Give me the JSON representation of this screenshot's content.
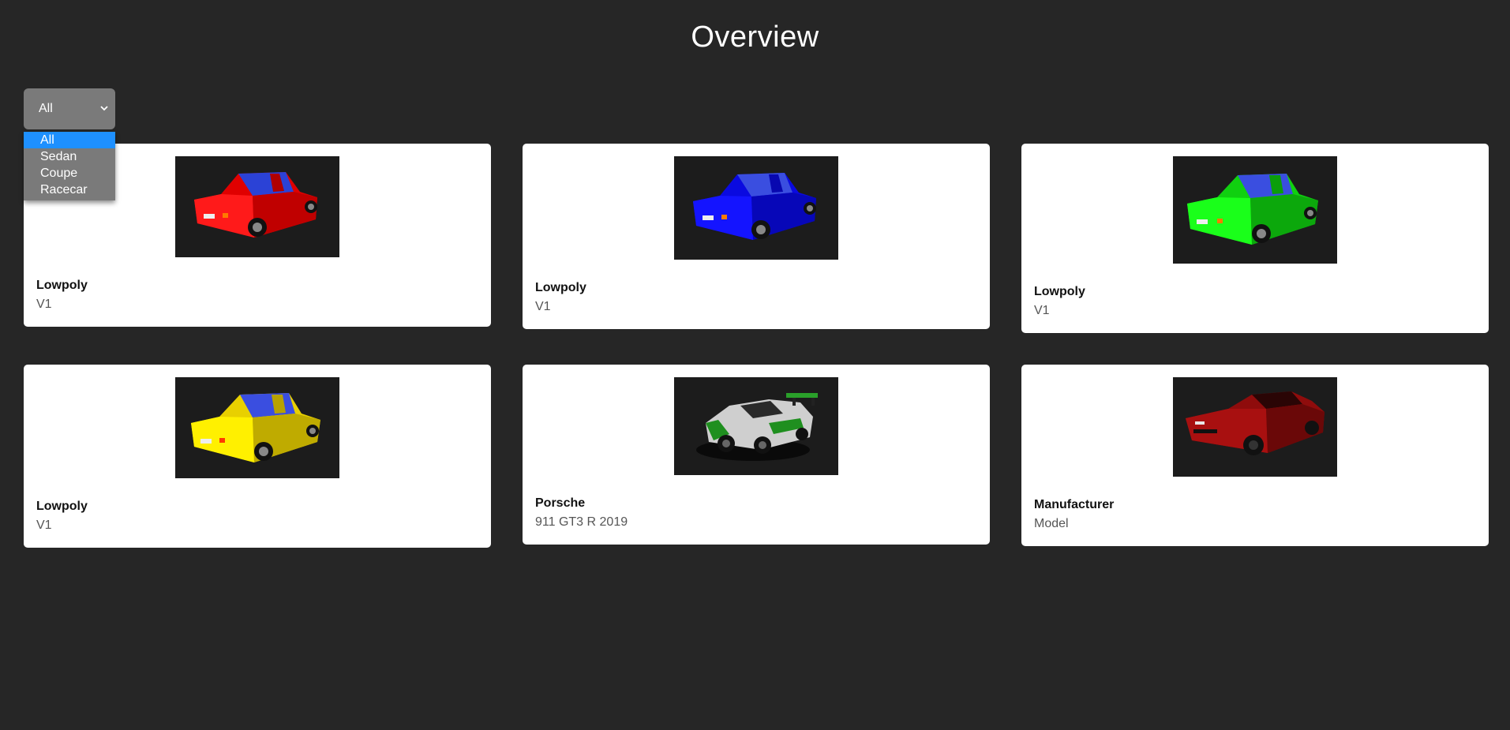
{
  "page": {
    "title": "Overview"
  },
  "filter": {
    "selected": "All",
    "options": [
      "All",
      "Sedan",
      "Coupe",
      "Racecar"
    ],
    "highlight_color": "#1e90ff"
  },
  "cards": [
    {
      "name": "Lowpoly",
      "model": "V1",
      "image": "red-lowpoly-sedan",
      "color": "#e00000"
    },
    {
      "name": "Lowpoly",
      "model": "V1",
      "image": "blue-lowpoly-sedan",
      "color": "#0a0ae0"
    },
    {
      "name": "Lowpoly",
      "model": "V1",
      "image": "green-lowpoly-sedan",
      "color": "#10d010"
    },
    {
      "name": "Lowpoly",
      "model": "V1",
      "image": "yellow-lowpoly-sedan",
      "color": "#e8d000"
    },
    {
      "name": "Porsche",
      "model": "911 GT3 R 2019",
      "image": "porsche-racecar",
      "color": "#cfcfcf"
    },
    {
      "name": "Manufacturer",
      "model": "Model",
      "image": "red-sports-coupe",
      "color": "#8f0c0c"
    }
  ],
  "colors": {
    "background": "#262626",
    "card": "#ffffff",
    "select": "#7a7a7a",
    "thumb_bg": "#242424"
  }
}
